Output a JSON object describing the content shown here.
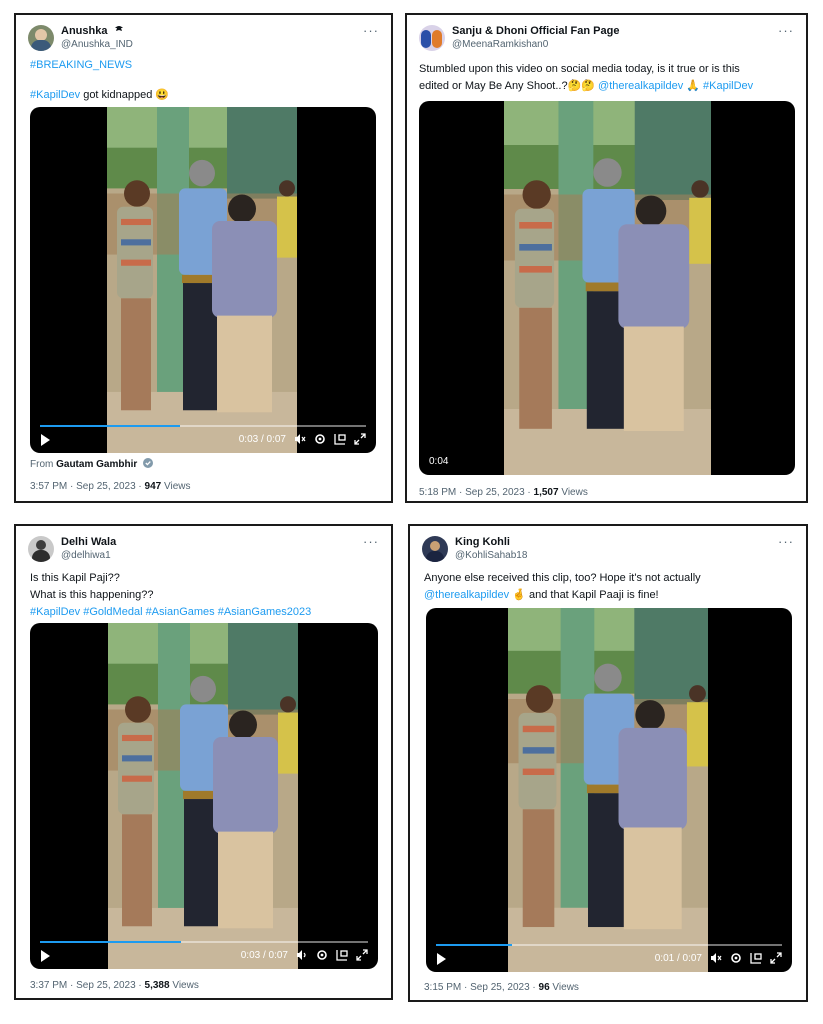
{
  "tweets": [
    {
      "name": "Anushka",
      "handle": "@Anushka_IND",
      "line1": "#BREAKING_NEWS",
      "line2_tag": "#KapilDev",
      "line2_text": " got kidnapped 😃",
      "timecode": "0:03 / 0:07",
      "from_prefix": "From ",
      "from_name": "Gautam Gambhir",
      "time": "3:57 PM · Sep 25, 2023 · ",
      "views_count": "947",
      "views_label": " Views",
      "progress": 0.43
    },
    {
      "name": "Sanju & Dhoni Official Fan Page",
      "handle": "@MeenaRamkishan0",
      "line1": "Stumbled upon this video on social media today, is it true or is this",
      "line2_text": "edited or May Be Any Shoot..?🤔🤔 ",
      "line2_tag1": "@therealkapildev",
      "line2_mid": " 🙏 ",
      "line2_tag2": "#KapilDev",
      "badge": "0:04",
      "time": "5:18 PM · Sep 25, 2023 · ",
      "views_count": "1,507",
      "views_label": " Views"
    },
    {
      "name": "Delhi Wala",
      "handle": "@delhiwa1",
      "line1": "Is this Kapil Paji??",
      "line2": "What is this happening??",
      "line3": "#KapilDev #GoldMedal #AsianGames #AsianGames2023",
      "timecode": "0:03 / 0:07",
      "time": "3:37 PM · Sep 25, 2023 · ",
      "views_count": "5,388",
      "views_label": " Views",
      "progress": 0.43
    },
    {
      "name": "King Kohli",
      "handle": "@KohliSahab18",
      "line1": "Anyone else received this clip, too? Hope it's not actually",
      "line2_tag": "@therealkapildev",
      "line2_text": " 🤞 and that Kapil Paaji is fine!",
      "timecode": "0:01 / 0:07",
      "time": "3:15 PM · Sep 25, 2023 · ",
      "views_count": "96",
      "views_label": " Views",
      "progress": 0.22
    }
  ],
  "colors": {
    "link": "#1d9bf0",
    "muted": "#536471",
    "text": "#0f1419"
  },
  "icons": [
    "more-icon",
    "verified-icon",
    "play-icon",
    "mute-icon",
    "settings-icon",
    "pip-icon",
    "fullscreen-icon"
  ]
}
